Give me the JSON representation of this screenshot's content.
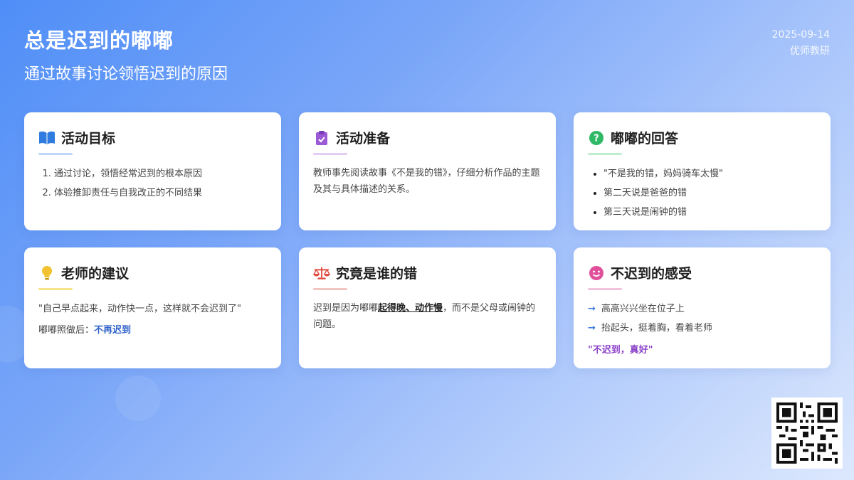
{
  "header": {
    "title": "总是迟到的嘟嘟",
    "subtitle": "通过故事讨论领悟迟到的原因",
    "date": "2025-09-14",
    "org": "优师教研"
  },
  "cards": {
    "goals": {
      "title": "活动目标",
      "icon": "book-icon",
      "items": [
        "通过讨论，领悟经常迟到的根本原因",
        "体验推卸责任与自我改正的不同结果"
      ]
    },
    "prep": {
      "title": "活动准备",
      "icon": "clipboard-check-icon",
      "text": "教师事先阅读故事《不是我的错》，仔细分析作品的主题及其与具体描述的关系。"
    },
    "answers": {
      "title": "嘟嘟的回答",
      "icon": "question-circle-icon",
      "items": [
        "\"不是我的错，妈妈骑车太慢\"",
        "第二天说是爸爸的错",
        "第三天说是闹钟的错"
      ]
    },
    "advice": {
      "title": "老师的建议",
      "icon": "lightbulb-icon",
      "quote": "\"自己早点起来，动作快一点，这样就不会迟到了\"",
      "after_label": "嘟嘟照做后：",
      "after_value": "不再迟到"
    },
    "fault": {
      "title": "究竟是谁的错",
      "icon": "scale-icon",
      "text_before": "迟到是因为嘟嘟",
      "text_emph": "起得晚、动作慢",
      "text_after": "，而不是父母或闹钟的问题。"
    },
    "feeling": {
      "title": "不迟到的感受",
      "icon": "smile-icon",
      "items": [
        "高高兴兴坐在位子上",
        "抬起头，挺着胸，看着老师"
      ],
      "quote": "\"不迟到，真好\""
    }
  },
  "colors": {
    "goals": "#2f7be0",
    "prep": "#9b59d6",
    "answers": "#2fb866",
    "advice": "#f2c230",
    "fault": "#e0483c",
    "feeling": "#e0509a"
  }
}
